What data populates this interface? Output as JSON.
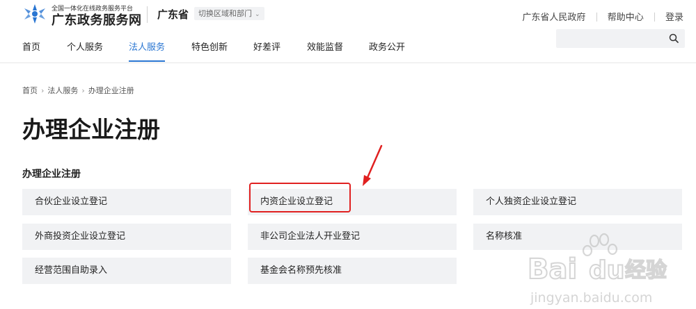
{
  "header": {
    "brand_subtitle": "全国一体化在线政务服务平台",
    "brand_title": "广东政务服务网",
    "province": "广东省",
    "region_selector": "切换区域和部门",
    "top_links": [
      "广东省人民政府",
      "帮助中心",
      "登录"
    ]
  },
  "nav": {
    "items": [
      "首页",
      "个人服务",
      "法人服务",
      "特色创新",
      "好差评",
      "效能监督",
      "政务公开"
    ],
    "active": "法人服务"
  },
  "search": {
    "value": "",
    "placeholder": ""
  },
  "breadcrumb": [
    "首页",
    "法人服务",
    "办理企业注册"
  ],
  "page_title": "办理企业注册",
  "section_title": "办理企业注册",
  "services": [
    "合伙企业设立登记",
    "内资企业设立登记",
    "个人独资企业设立登记",
    "外商投资企业设立登记",
    "非公司企业法人开业登记",
    "名称核准",
    "经营范围自助录入",
    "基金会名称预先核准"
  ],
  "colors": {
    "accent": "#2a76d2",
    "highlight": "#e02020",
    "card_bg": "#f1f2f4"
  },
  "watermark": {
    "brand_left": "Bai",
    "brand_right": "du",
    "brand_cn": "经验",
    "url": "jingyan.baidu.com"
  }
}
